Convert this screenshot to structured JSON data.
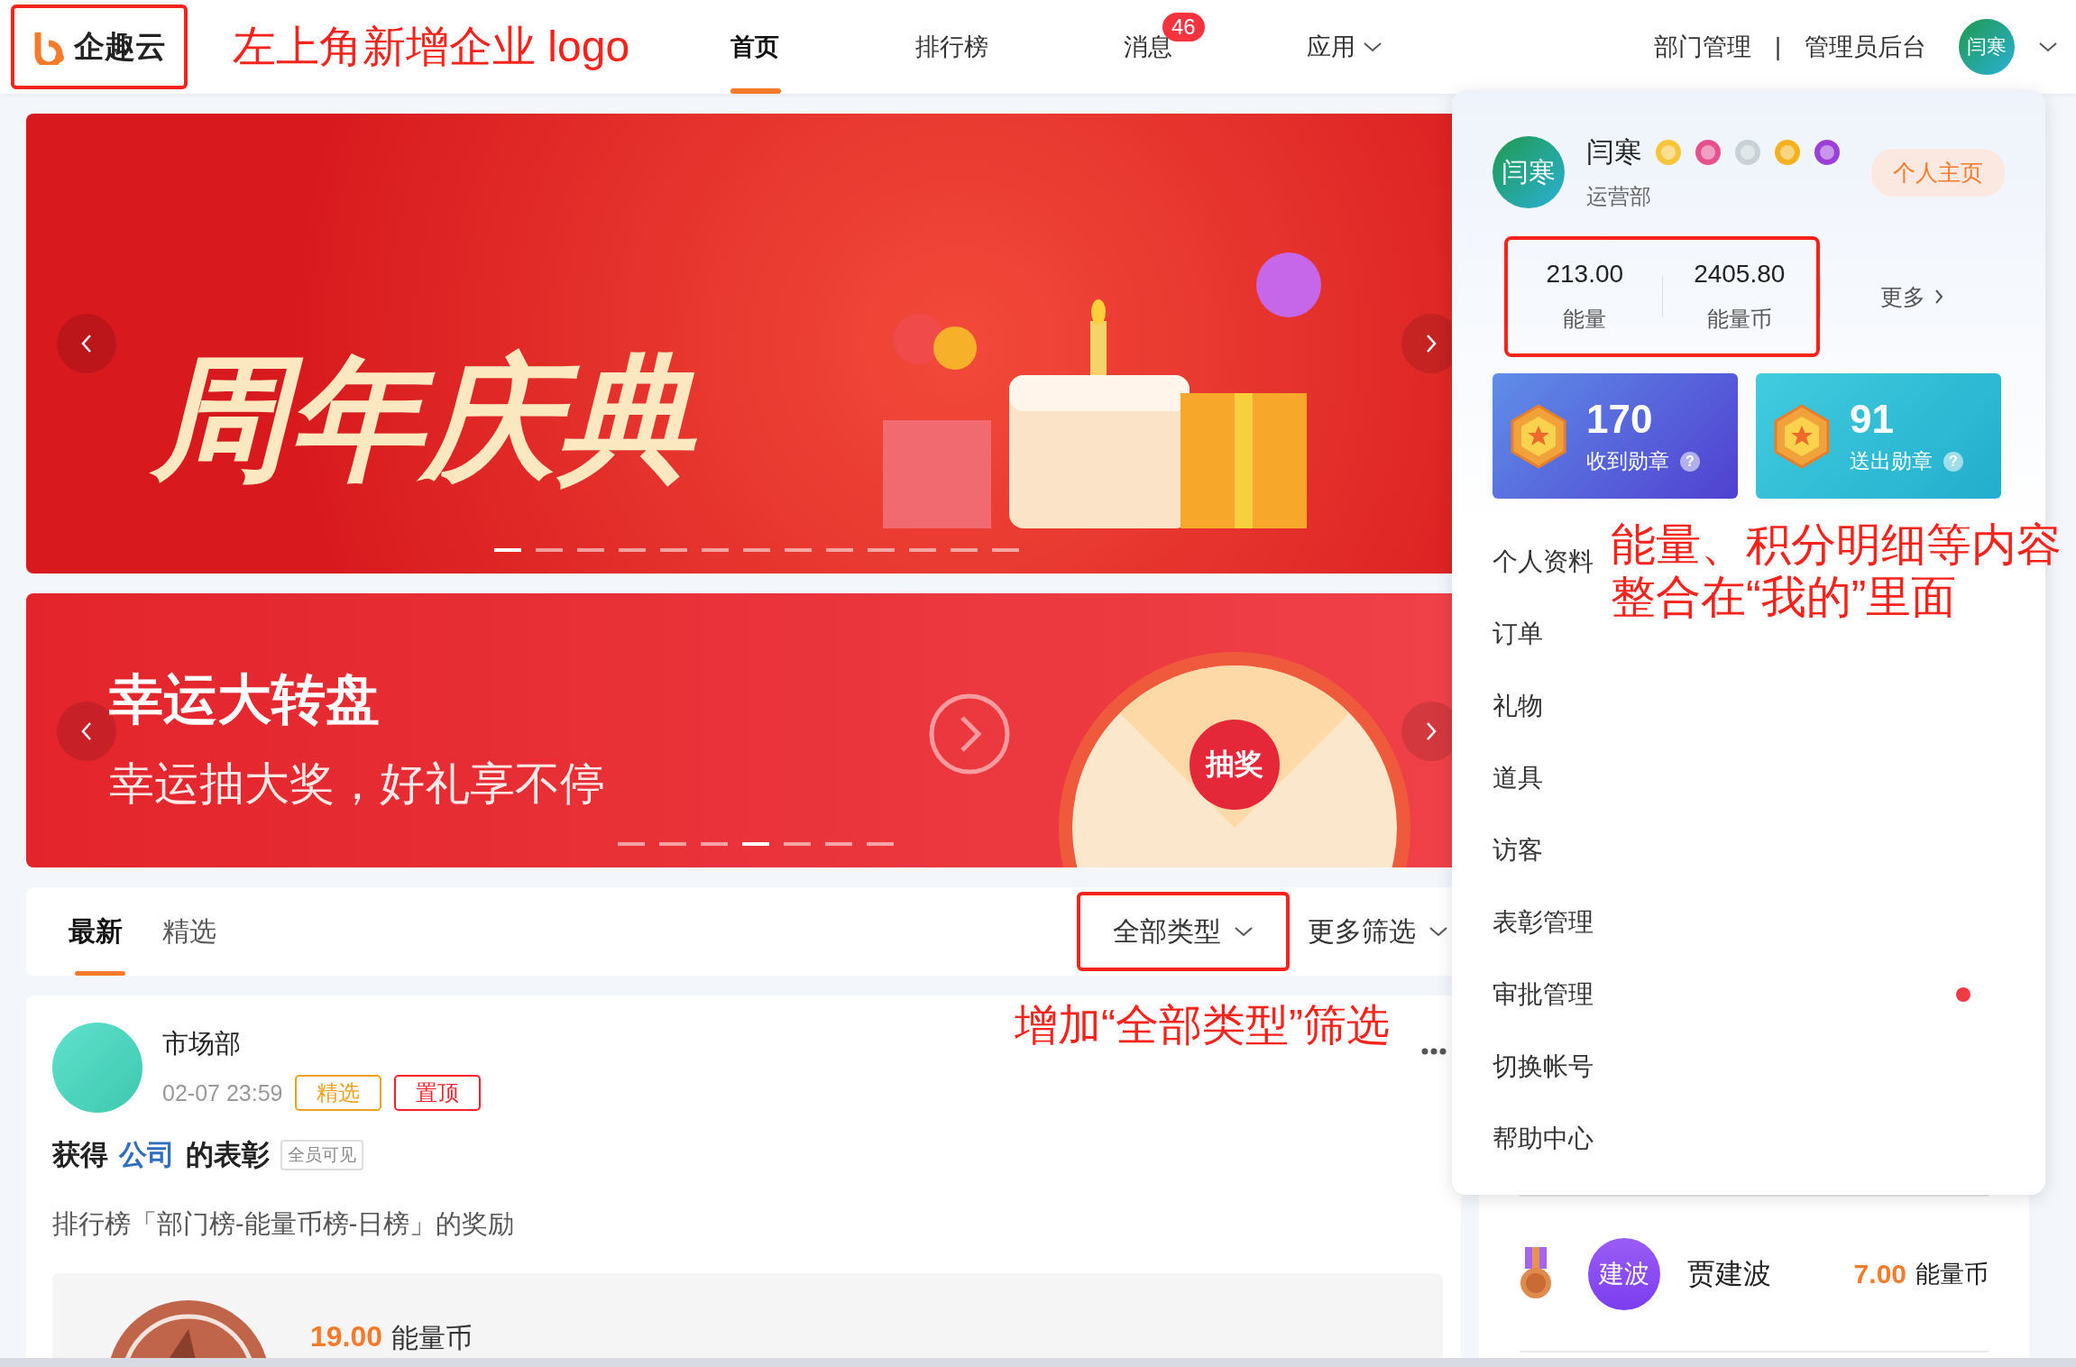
{
  "header": {
    "logo": {
      "text": "企趣云",
      "highlighted": true
    },
    "annotation": "左上角新增企业 logo",
    "nav": [
      {
        "label": "首页",
        "selected": true
      },
      {
        "label": "排行榜",
        "selected": false
      },
      {
        "label": "消息",
        "selected": false,
        "badge": "46"
      },
      {
        "label": "应用",
        "selected": false,
        "dropdown": true
      }
    ],
    "links": [
      "部门管理",
      "管理员后台"
    ],
    "separator": "|",
    "avatar": "闫寒"
  },
  "banners": [
    {
      "kind": "anniversary",
      "title": "周年庆典",
      "dots": [
        {
          "selected": true
        },
        {
          "selected": false
        },
        {
          "selected": false
        },
        {
          "selected": false
        },
        {
          "selected": false
        },
        {
          "selected": false
        },
        {
          "selected": false
        },
        {
          "selected": false
        },
        {
          "selected": false
        },
        {
          "selected": false
        },
        {
          "selected": false
        },
        {
          "selected": false
        },
        {
          "selected": false
        }
      ]
    },
    {
      "kind": "lucky_wheel",
      "title": "幸运大转盘",
      "subtitle": "幸运抽大奖，好礼享不停",
      "wheel_label": "抽奖",
      "dots": [
        {
          "selected": false
        },
        {
          "selected": false
        },
        {
          "selected": false
        },
        {
          "selected": true
        },
        {
          "selected": false
        },
        {
          "selected": false
        },
        {
          "selected": false
        }
      ]
    }
  ],
  "feed": {
    "tabs": [
      {
        "label": "最新",
        "selected": true
      },
      {
        "label": "精选",
        "selected": false
      }
    ],
    "filters": [
      {
        "label": "全部类型",
        "highlighted": true
      },
      {
        "label": "更多筛选",
        "highlighted": false
      }
    ],
    "annotation": "增加“全部类型”筛选",
    "post": {
      "author": "市场部",
      "time": "02-07 23:59",
      "tags": [
        {
          "label": "精选",
          "color": "#f0a020"
        },
        {
          "label": "置顶",
          "color": "#f5222d"
        }
      ],
      "title_before": "获得",
      "title_link": "公司",
      "title_after": "的表彰",
      "visibility": "全员可见",
      "description": "排行榜「部门榜-能量币榜-日榜」的奖励",
      "reward_amount": "19.00",
      "reward_unit": "能量币"
    }
  },
  "profile_menu": {
    "avatar": "闫寒",
    "name": "闫寒",
    "department": "运营部",
    "home_button": "个人主页",
    "stats": {
      "highlighted": true,
      "items": [
        {
          "value": "213.00",
          "label": "能量"
        },
        {
          "value": "2405.80",
          "label": "能量币"
        }
      ]
    },
    "more": "更多",
    "medals": [
      {
        "kind": "received",
        "value": "170",
        "label": "收到勋章",
        "help": "?"
      },
      {
        "kind": "sent",
        "value": "91",
        "label": "送出勋章",
        "help": "?"
      }
    ],
    "items": [
      {
        "label": "个人资料",
        "dot": false
      },
      {
        "label": "订单",
        "dot": false
      },
      {
        "label": "礼物",
        "dot": false
      },
      {
        "label": "道具",
        "dot": false
      },
      {
        "label": "访客",
        "dot": false
      },
      {
        "label": "表彰管理",
        "dot": false
      },
      {
        "label": "审批管理",
        "dot": true
      },
      {
        "label": "切换帐号",
        "dot": false
      },
      {
        "label": "帮助中心",
        "dot": false
      }
    ],
    "annotation": [
      "能量、积分明细等内容",
      "整合在“我的”里面"
    ]
  },
  "ranking": {
    "avatar": "建波",
    "name": "贾建波",
    "amount": "7.00",
    "unit": "能量币"
  }
}
